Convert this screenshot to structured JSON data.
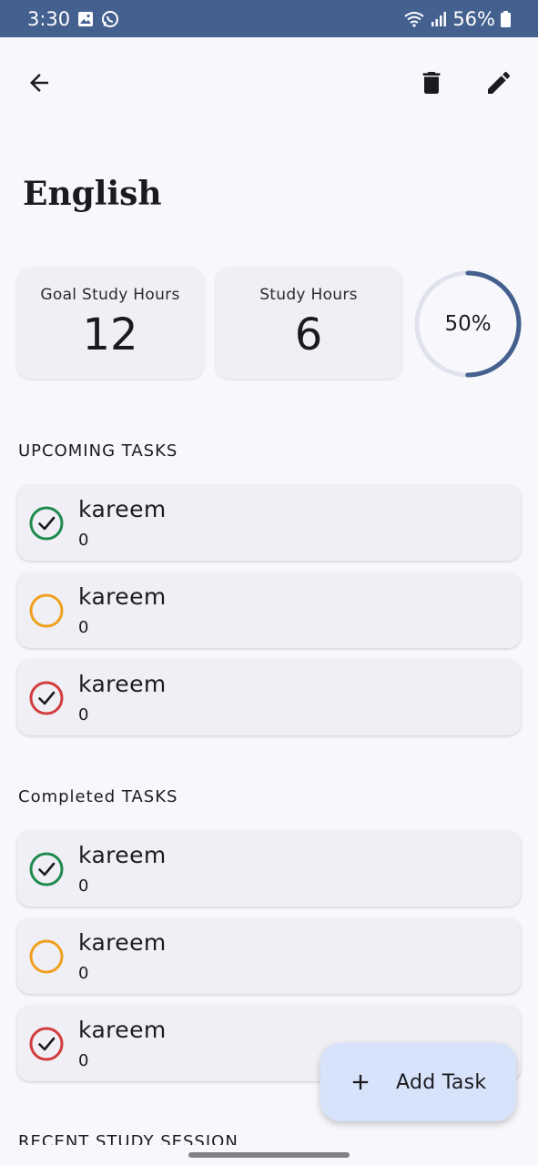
{
  "status_bar": {
    "time": "3:30",
    "battery": "56%"
  },
  "subject": {
    "title": "English"
  },
  "stats": {
    "goal": {
      "label": "Goal Study Hours",
      "value": "12"
    },
    "study": {
      "label": "Study Hours",
      "value": "6"
    },
    "progress": {
      "label": "50%",
      "fraction": 0.5,
      "color": "#43608e",
      "track_color": "#e0e2ec"
    }
  },
  "upcoming": {
    "header": "UPCOMING TASKS",
    "tasks": [
      {
        "title": "kareem",
        "subtitle": "0",
        "color": "#1e8a4c",
        "checked": true
      },
      {
        "title": "kareem",
        "subtitle": "0",
        "color": "#f0a01e",
        "checked": false
      },
      {
        "title": "kareem",
        "subtitle": "0",
        "color": "#d23c3c",
        "checked": true
      }
    ]
  },
  "completed": {
    "header": "Completed TASKS",
    "tasks": [
      {
        "title": "kareem",
        "subtitle": "0",
        "color": "#1e8a4c",
        "checked": true
      },
      {
        "title": "kareem",
        "subtitle": "0",
        "color": "#f0a01e",
        "checked": false
      },
      {
        "title": "kareem",
        "subtitle": "0",
        "color": "#d23c3c",
        "checked": true
      }
    ]
  },
  "recent": {
    "header": "RECENT STUDY SESSION"
  },
  "fab": {
    "label": "Add Task",
    "icon": "plus-icon"
  }
}
